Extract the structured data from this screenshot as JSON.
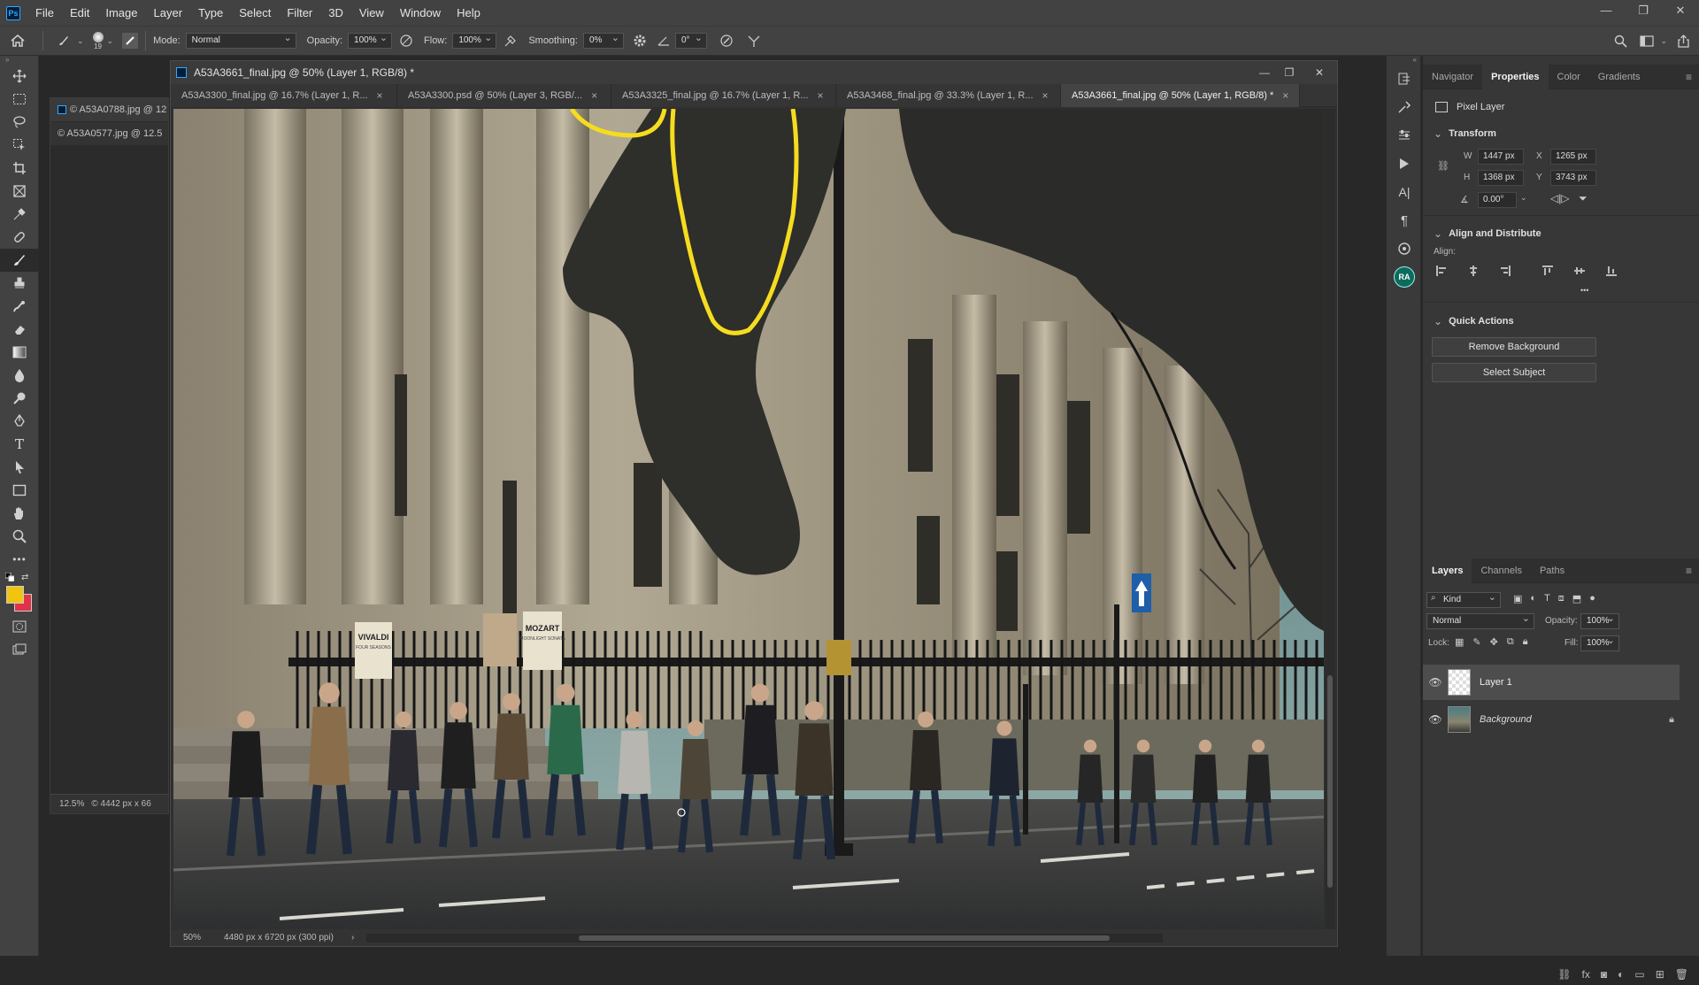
{
  "app": {
    "logo": "Ps"
  },
  "menu": [
    "File",
    "Edit",
    "Image",
    "Layer",
    "Type",
    "Select",
    "Filter",
    "3D",
    "View",
    "Window",
    "Help"
  ],
  "window_controls": [
    "—",
    "❐",
    "✕"
  ],
  "options": {
    "brush_size": "19",
    "mode_label": "Mode:",
    "mode_value": "Normal",
    "opacity_label": "Opacity:",
    "opacity_value": "100%",
    "flow_label": "Flow:",
    "flow_value": "100%",
    "smoothing_label": "Smoothing:",
    "smoothing_value": "0%",
    "angle_value": "0°"
  },
  "colors": {
    "foreground": "#f1c40f",
    "background": "#e0334a",
    "accent_blue": "#31a8ff",
    "stroke_yellow": "#f5dc1f"
  },
  "float_docs": {
    "tabs": [
      "© A53A0788.jpg @ 12",
      "© A53A0577.jpg @ 12.5"
    ],
    "zoom": "12.5%",
    "size": "© 4442 px x 66"
  },
  "document": {
    "title": "A53A3661_final.jpg @ 50% (Layer 1, RGB/8) *",
    "tabs": [
      {
        "label": "A53A3300_final.jpg @ 16.7% (Layer 1, R...",
        "close": "×"
      },
      {
        "label": "A53A3300.psd @ 50% (Layer 3, RGB/...",
        "close": "×"
      },
      {
        "label": "A53A3325_final.jpg @ 16.7% (Layer 1, R...",
        "close": "×"
      },
      {
        "label": "A53A3468_final.jpg @ 33.3% (Layer 1, R...",
        "close": "×"
      },
      {
        "label": "A53A3661_final.jpg @ 50% (Layer 1, RGB/8) *",
        "close": "×"
      }
    ],
    "zoom": "50%",
    "dimensions": "4480 px x 6720 px (300 ppi)",
    "signs": {
      "left": "VIVALDI",
      "left_sub": "FOUR SEASONS",
      "right": "MOZART",
      "right_sub": "MOONLIGHT SONATA"
    }
  },
  "right_panel": {
    "tabs": [
      "Navigator",
      "Properties",
      "Color",
      "Gradients"
    ],
    "layer_type": "Pixel Layer",
    "transform": {
      "title": "Transform",
      "w_label": "W",
      "w": "1447 px",
      "h_label": "H",
      "h": "1368 px",
      "x_label": "X",
      "x": "1265 px",
      "y_label": "Y",
      "y": "3743 px",
      "angle": "0.00°"
    },
    "align": {
      "title": "Align and Distribute",
      "label": "Align:",
      "more": "•••"
    },
    "quick_actions": {
      "title": "Quick Actions",
      "remove_bg": "Remove Background",
      "select_subject": "Select Subject"
    }
  },
  "layers_panel": {
    "tabs": [
      "Layers",
      "Channels",
      "Paths"
    ],
    "filter_kind": "Kind",
    "blend": "Normal",
    "opacity_label": "Opacity:",
    "opacity": "100%",
    "lock_label": "Lock:",
    "fill_label": "Fill:",
    "fill": "100%",
    "layers": [
      {
        "name": "Layer 1",
        "selected": true
      },
      {
        "name": "Background",
        "selected": false,
        "locked": true
      }
    ]
  },
  "icon_strip": {
    "ra": "RA"
  }
}
